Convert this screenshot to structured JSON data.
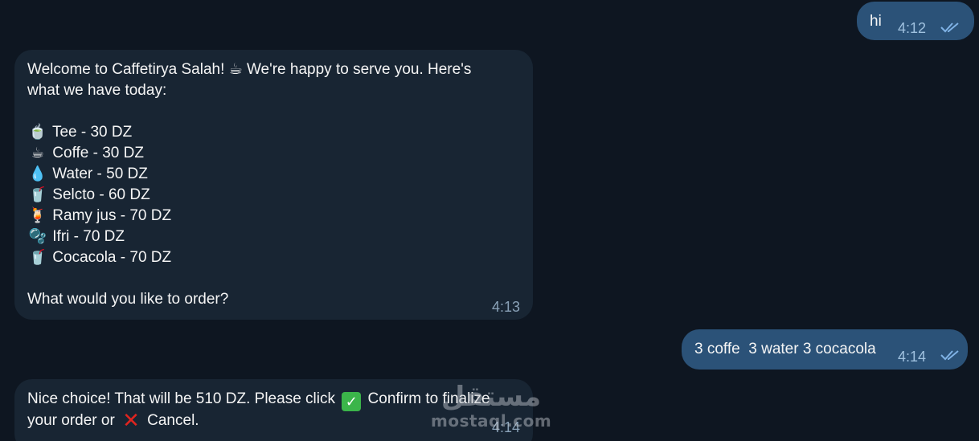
{
  "messages": [
    {
      "direction": "outgoing",
      "text": "hi",
      "time": "4:12",
      "status": "read-double-check"
    },
    {
      "direction": "incoming",
      "lines": [
        "Welcome to Caffetirya Salah! ☕ We're happy to serve you. Here's",
        "what we have today:"
      ],
      "menu": [
        {
          "icon": "🍵",
          "icon_name": "teacup-icon",
          "text": "Tee - 30 DZ"
        },
        {
          "icon": "☕",
          "icon_name": "hot-beverage-icon",
          "text": "Coffe - 30 DZ"
        },
        {
          "icon": "💧",
          "icon_name": "droplet-icon",
          "text": "Water - 50 DZ"
        },
        {
          "icon": "🥤",
          "icon_name": "cup-with-straw-icon",
          "text": "Selcto - 60 DZ"
        },
        {
          "icon": "🍹",
          "icon_name": "tropical-drink-icon",
          "text": "Ramy jus - 70 DZ"
        },
        {
          "icon": "🫧",
          "icon_name": "bubbles-icon",
          "text": "Ifri - 70 DZ"
        },
        {
          "icon": "🥤",
          "icon_name": "cup-with-straw-icon",
          "text": "Cocacola - 70 DZ"
        }
      ],
      "closing": "What would you like to order?",
      "time": "4:13"
    },
    {
      "direction": "outgoing",
      "text": "3 coffe  3 water 3 cocacola",
      "time": "4:14",
      "status": "read-double-check"
    },
    {
      "direction": "incoming",
      "part1": "Nice choice! That will be 510 DZ. Please click",
      "check_glyph": "✓",
      "part2": "Confirm to finalize",
      "part3": "your order or",
      "cross_glyph": "✕",
      "part4": "Cancel.",
      "time": "4:14"
    }
  ],
  "watermark": {
    "arabic": "مستقل",
    "latin": "mostaql.com"
  },
  "colors": {
    "background": "#0e1621",
    "incoming_bubble": "#182533",
    "outgoing_bubble": "#2b5278",
    "read_check": "#7fb2e5"
  }
}
